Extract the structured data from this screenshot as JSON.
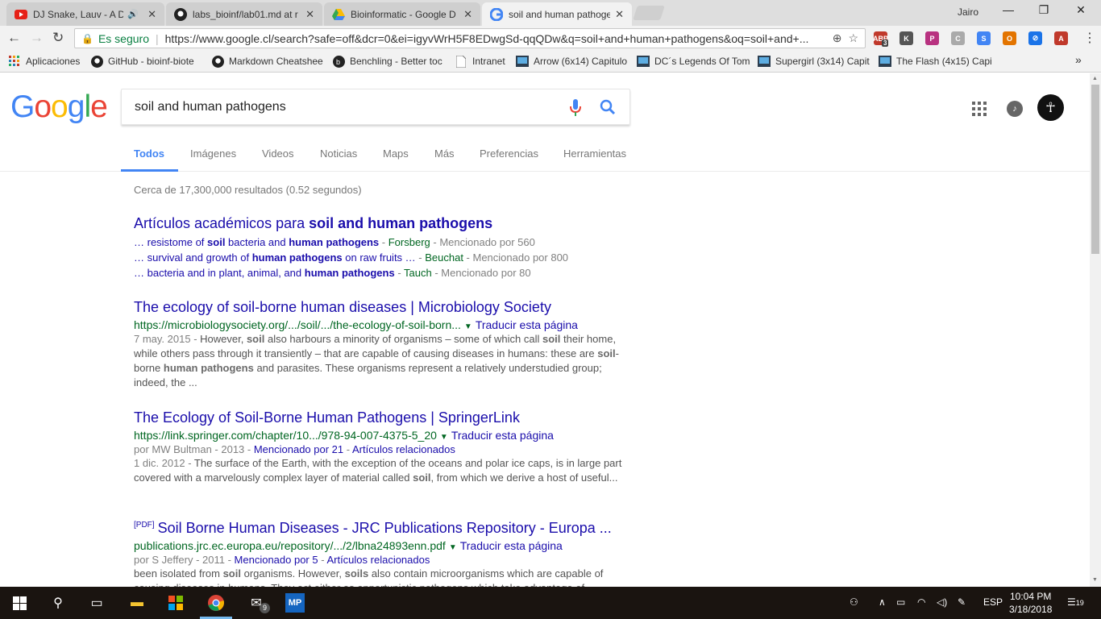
{
  "browser": {
    "tabs": [
      {
        "label": "DJ Snake, Lauv - A Dif",
        "icon": "youtube-icon",
        "active": false
      },
      {
        "label": "labs_bioinf/lab01.md at r",
        "icon": "github-icon",
        "active": false
      },
      {
        "label": "Bioinformatic - Google D",
        "icon": "google-drive-icon",
        "active": false
      },
      {
        "label": "soil and human pathoge",
        "icon": "google-icon",
        "active": true
      }
    ],
    "user": "Jairo",
    "secure_label": "Es seguro",
    "url": "https://www.google.cl/search?safe=off&dcr=0&ei=igyvWrH5F8EDwgSd-qqQDw&q=soil+and+human+pathogens&oq=soil+and+...",
    "extensions": [
      {
        "name": "adblock-icon",
        "label": "ABP",
        "badge": "3",
        "color": "#c0392b"
      },
      {
        "name": "keep-icon",
        "label": "K",
        "color": "#555"
      },
      {
        "name": "paint-icon",
        "label": "P",
        "color": "#b83280"
      },
      {
        "name": "camera-icon",
        "label": "C",
        "color": "#aaa"
      },
      {
        "name": "scholar-icon",
        "label": "S",
        "color": "#4285f4"
      },
      {
        "name": "color-picker-icon",
        "label": "O",
        "color": "#e37400"
      },
      {
        "name": "block-icon",
        "label": "⊘",
        "color": "#1a73e8"
      },
      {
        "name": "pdf-icon",
        "label": "A",
        "color": "#c0392b"
      }
    ],
    "bookmarks": [
      {
        "label": "Aplicaciones",
        "icon": "apps-grid-icon"
      },
      {
        "label": "GitHub - bioinf-biote",
        "icon": "github-icon"
      },
      {
        "label": "Markdown Cheatshee",
        "icon": "github-icon"
      },
      {
        "label": "Benchling - Better toc",
        "icon": "benchling-icon"
      },
      {
        "label": "Intranet",
        "icon": "page-icon"
      },
      {
        "label": "Arrow (6x14) Capitulo",
        "icon": "tv-icon"
      },
      {
        "label": "DC´s Legends Of Tom",
        "icon": "tv-icon"
      },
      {
        "label": "Supergirl (3x14) Capit",
        "icon": "tv-icon"
      },
      {
        "label": "The Flash (4x15) Capi",
        "icon": "tv-icon"
      }
    ],
    "more_bookmarks": "»"
  },
  "google": {
    "logo_letters": [
      {
        "ch": "G",
        "color": "#4285f4"
      },
      {
        "ch": "o",
        "color": "#ea4335"
      },
      {
        "ch": "o",
        "color": "#fbbc05"
      },
      {
        "ch": "g",
        "color": "#4285f4"
      },
      {
        "ch": "l",
        "color": "#34a853"
      },
      {
        "ch": "e",
        "color": "#ea4335"
      }
    ],
    "query": "soil and human pathogens",
    "nav": [
      "Todos",
      "Imágenes",
      "Videos",
      "Noticias",
      "Maps",
      "Más",
      "Preferencias",
      "Herramientas"
    ],
    "stats": "Cerca de 17,300,000 resultados (0.52 segundos)",
    "scholar": {
      "title_prefix": "Artículos académicos para ",
      "title_query": "soil and human pathogens",
      "items": [
        {
          "pre": "… resistome of ",
          "b1": "soil",
          "mid": " bacteria and ",
          "b2": "human pathogens",
          "post": "",
          "author": "Forsberg",
          "cited": "Mencionado por 560"
        },
        {
          "pre": "… survival and growth of ",
          "b1": "human pathogens",
          "mid": " on raw fruits …",
          "b2": "",
          "post": "",
          "author": "Beuchat",
          "cited": "Mencionado por 800"
        },
        {
          "pre": "… bacteria and in plant, animal, and ",
          "b1": "human pathogens",
          "mid": "",
          "b2": "",
          "post": "",
          "author": "Tauch",
          "cited": "Mencionado por 80"
        }
      ]
    },
    "results": [
      {
        "title": "The ecology of soil-borne human diseases | Microbiology Society",
        "url": "https://microbiologysociety.org/.../soil/.../the-ecology-of-soil-born...",
        "translate": "Traducir esta página",
        "meta": "",
        "date": "7 may. 2015 - ",
        "snippet_parts": [
          "However, ",
          "soil",
          " also harbours a minority of organisms – some of which call ",
          "soil",
          " their home, while others pass through it transiently – that are capable of causing diseases in humans: these are ",
          "soil",
          "-borne ",
          "human pathogens",
          " and parasites. These organisms represent a relatively understudied group; indeed, the ..."
        ]
      },
      {
        "title": "The Ecology of Soil-Borne Human Pathogens | SpringerLink",
        "url": "https://link.springer.com/chapter/10.../978-94-007-4375-5_20",
        "translate": "Traducir esta página",
        "meta_author": "por MW Bultman - 2013 - ",
        "meta_cited": "Mencionado por 21",
        "meta_related": "Artículos relacionados",
        "date": "1 dic. 2012 - ",
        "snippet_parts": [
          "The surface of the Earth, with the exception of the oceans and polar ice caps, is in large part covered with a marvelously complex layer of material called ",
          "soil",
          ", from which we derive a host of useful..."
        ]
      },
      {
        "pdf_tag": "[PDF]",
        "title": "Soil Borne Human Diseases - JRC Publications Repository - Europa ...",
        "url": "publications.jrc.ec.europa.eu/repository/.../2/lbna24893enn.pdf",
        "translate": "Traducir esta página",
        "meta_author": "por S Jeffery - 2011 - ",
        "meta_cited": "Mencionado por 5",
        "meta_related": "Artículos relacionados",
        "date": "",
        "snippet_parts": [
          "been isolated from ",
          "soil",
          " organisms. However, ",
          "soils",
          " also contain microorganisms which are capable of causing diseases in humans. They act either as opportunistic pathogens which take advantage of"
        ]
      }
    ]
  },
  "taskbar": {
    "mail_badge": "9",
    "mp_label": "MP",
    "lang": "ESP",
    "time": "10:04 PM",
    "date": "3/18/2018",
    "notifications": "19"
  }
}
